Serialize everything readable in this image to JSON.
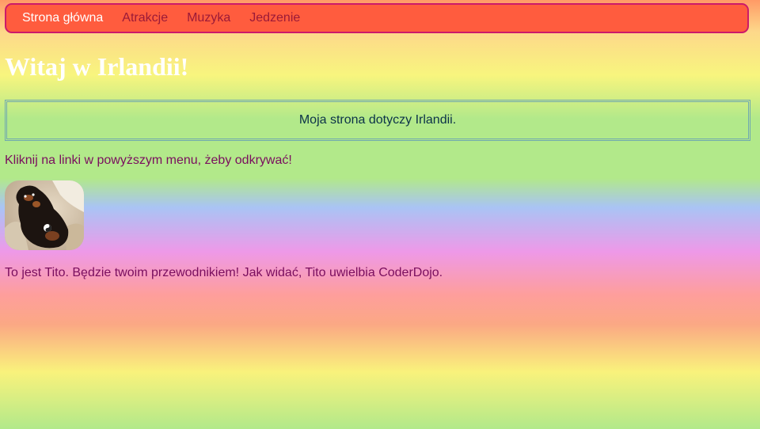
{
  "nav": {
    "items": [
      {
        "label": "Strona główna",
        "active": true
      },
      {
        "label": "Atrakcje",
        "active": false
      },
      {
        "label": "Muzyka",
        "active": false
      },
      {
        "label": "Jedzenie",
        "active": false
      }
    ]
  },
  "main": {
    "title": "Witaj w Irlandii!",
    "intro": "Moja strona dotyczy Irlandii.",
    "instruction": "Kliknij na linki w powyższym menu, żeby odkrywać!",
    "photo_icon": "dog-photo",
    "caption": "To jest Tito. Będzie twoim przewodnikiem! Jak widać, Tito uwielbia CoderDojo."
  },
  "colors": {
    "nav_bg": "#ff5c3e",
    "nav_border": "#cc1a6a",
    "nav_active": "#ffffff",
    "nav_link": "#9b1a38",
    "text": "#7a0e5e",
    "intro_text": "#0c3248",
    "title": "#ffffff"
  }
}
